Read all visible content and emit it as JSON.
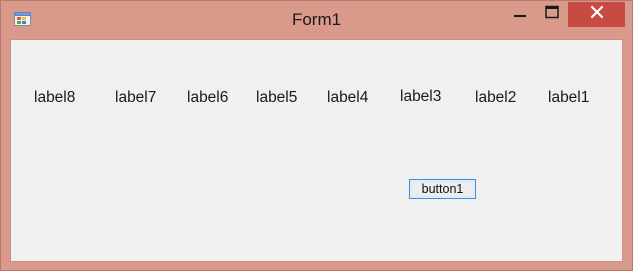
{
  "window": {
    "title": "Form1"
  },
  "titlebar_buttons": {
    "minimize_icon": "minimize-icon",
    "maximize_icon": "maximize-icon",
    "close_icon": "close-icon"
  },
  "labels": [
    "label8",
    "label7",
    "label6",
    "label5",
    "label4",
    "label3",
    "label2",
    "label1"
  ],
  "button": {
    "label": "button1"
  },
  "colors": {
    "titlebar": "#d9998b",
    "close_button": "#c74b43",
    "client_background": "#f0f0f0",
    "button_focus_border": "#3c8fe0"
  }
}
